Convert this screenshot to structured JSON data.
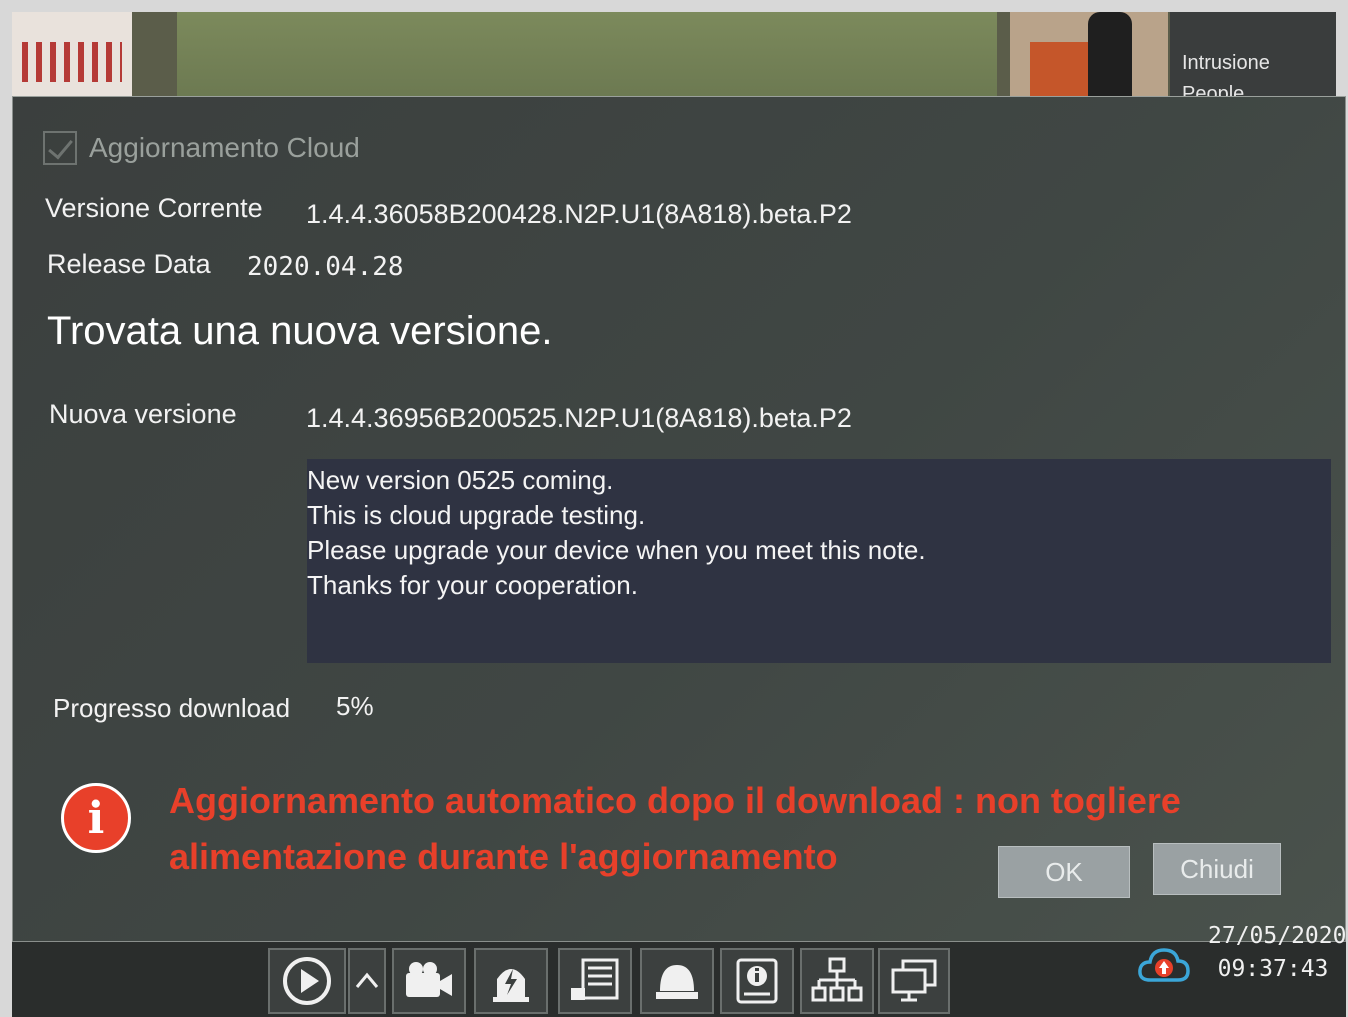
{
  "camera": {
    "labels": [
      "Intrusione",
      "People"
    ]
  },
  "dialog": {
    "title": "Aggiornamento Cloud",
    "current_version_label": "Versione Corrente",
    "current_version": "1.4.4.36058B200428.N2P.U1(8A818).beta.P2",
    "release_label": "Release Data",
    "release_date": "2020.04.28",
    "found_heading": "Trovata una nuova versione.",
    "new_version_label": "Nuova versione",
    "new_version": "1.4.4.36956B200525.N2P.U1(8A818).beta.P2",
    "notes": [
      "New version 0525 coming.",
      "This is cloud upgrade testing.",
      "Please upgrade your device when you meet this note.",
      "Thanks for your cooperation."
    ],
    "progress_label": "Progresso download",
    "progress_value": "5%",
    "warning": "Aggiornamento automatico dopo il download : non togliere alimentazione durante l'aggiornamento",
    "ok_label": "OK",
    "close_label": "Chiudi"
  },
  "taskbar": {
    "icons": [
      "play-icon",
      "chevron-up-icon",
      "camera-icon",
      "alarm-icon",
      "record-list-icon",
      "dome-camera-icon",
      "info-device-icon",
      "network-icon",
      "display-icon"
    ],
    "date": "27/05/2020",
    "time": "09:37:43"
  },
  "colors": {
    "warning": "#e8402a",
    "dialog_bg": "#3e4442",
    "notes_bg": "#2f3342",
    "cloud_icon": "#3ba6d8"
  }
}
